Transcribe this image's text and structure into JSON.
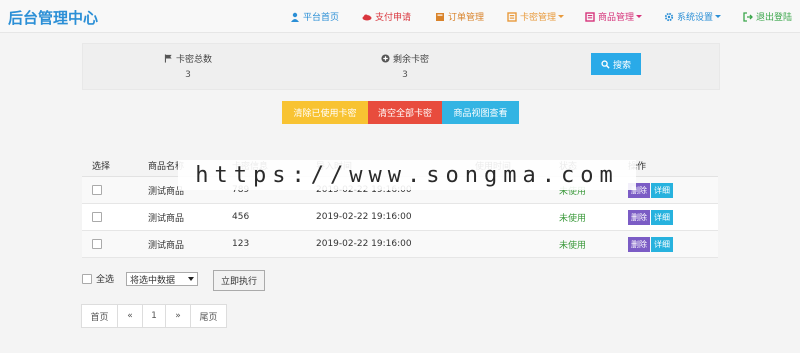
{
  "brand": {
    "title": "后台管理中心",
    "color": "#2b8fd6"
  },
  "nav": [
    {
      "label": "平台首页",
      "icon": "user-icon",
      "color": "#2b8fd6",
      "dropdown": false
    },
    {
      "label": "支付申请",
      "icon": "cloud-icon",
      "color": "#d9363e",
      "dropdown": false
    },
    {
      "label": "订单管理",
      "icon": "folder-icon",
      "color": "#d9832b",
      "dropdown": false
    },
    {
      "label": "卡密管理",
      "icon": "card-icon",
      "color": "#e89a3c",
      "dropdown": true
    },
    {
      "label": "商品管理",
      "icon": "list-icon",
      "color": "#d6337a",
      "dropdown": true
    },
    {
      "label": "系统设置",
      "icon": "gear-icon",
      "color": "#2b8fd6",
      "dropdown": true
    },
    {
      "label": "退出登陆",
      "icon": "logout-icon",
      "color": "#3aa64a",
      "dropdown": false
    }
  ],
  "stats": [
    {
      "label": "卡密总数",
      "icon": "flag-icon",
      "value": "3"
    },
    {
      "label": "剩余卡密",
      "icon": "plus-circle-icon",
      "value": "3"
    }
  ],
  "search": {
    "label": "搜索",
    "icon": "search-icon"
  },
  "actions": [
    {
      "label": "清除已使用卡密",
      "color": "#f8c332"
    },
    {
      "label": "清空全部卡密",
      "color": "#e84c3d"
    },
    {
      "label": "商品视图查看",
      "color": "#33b4e3"
    }
  ],
  "table": {
    "headers": [
      "选择",
      "商品名称",
      "卡密信息",
      "导入时间",
      "使用时间",
      "状态",
      "操作"
    ],
    "rows": [
      {
        "product": "测试商品",
        "card": "789",
        "imported": "2019-02-22 19:16:00",
        "used": "",
        "status": "未使用"
      },
      {
        "product": "测试商品",
        "card": "456",
        "imported": "2019-02-22 19:16:00",
        "used": "",
        "status": "未使用"
      },
      {
        "product": "测试商品",
        "card": "123",
        "imported": "2019-02-22 19:16:00",
        "used": "",
        "status": "未使用"
      }
    ],
    "delete_label": "删除",
    "detail_label": "详细"
  },
  "bulk": {
    "select_all": "全选",
    "select_value": "将选中数据",
    "execute": "立即执行"
  },
  "pager": [
    "首页",
    "«",
    "1",
    "»",
    "尾页"
  ],
  "watermark": "https://www.songma.com"
}
